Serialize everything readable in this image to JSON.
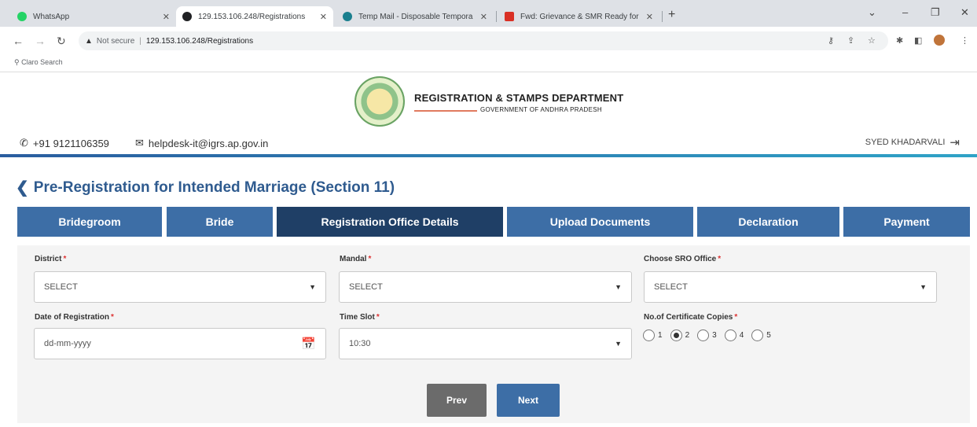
{
  "browser": {
    "tabs": [
      {
        "title": "WhatsApp",
        "fav_color": "#25d366"
      },
      {
        "title": "129.153.106.248/Registrations",
        "fav_color": "#202124"
      },
      {
        "title": "Temp Mail - Disposable Tempora",
        "fav_color": "#1a7f8e"
      },
      {
        "title": "Fwd: Grievance & SMR Ready for",
        "fav_color": "#d93025"
      }
    ],
    "security_label": "Not secure",
    "url": "129.153.106.248/Registrations",
    "bookmark": "Claro Search"
  },
  "header": {
    "dept_title": "REGISTRATION & STAMPS DEPARTMENT",
    "dept_sub": "GOVERNMENT OF ANDHRA PRADESH",
    "phone": "+91 9121106359",
    "email": "helpdesk-it@igrs.ap.gov.in",
    "user": "SYED KHADARVALI"
  },
  "page": {
    "title": "Pre-Registration for Intended Marriage (Section 11)"
  },
  "steps": [
    {
      "label": "Bridegroom"
    },
    {
      "label": "Bride"
    },
    {
      "label": "Registration Office Details"
    },
    {
      "label": "Upload Documents"
    },
    {
      "label": "Declaration"
    },
    {
      "label": "Payment"
    }
  ],
  "active_step": "Registration Office Details",
  "form": {
    "district": {
      "label": "District",
      "value": "SELECT"
    },
    "mandal": {
      "label": "Mandal",
      "value": "SELECT"
    },
    "sro": {
      "label": "Choose SRO Office",
      "value": "SELECT"
    },
    "date": {
      "label": "Date of Registration",
      "placeholder": "dd-mm-yyyy"
    },
    "time": {
      "label": "Time Slot",
      "value": "10:30"
    },
    "copies": {
      "label": "No.of Certificate Copies",
      "options": [
        "1",
        "2",
        "3",
        "4",
        "5"
      ],
      "selected": "2"
    },
    "required_mark": "*"
  },
  "buttons": {
    "prev": "Prev",
    "next": "Next"
  }
}
